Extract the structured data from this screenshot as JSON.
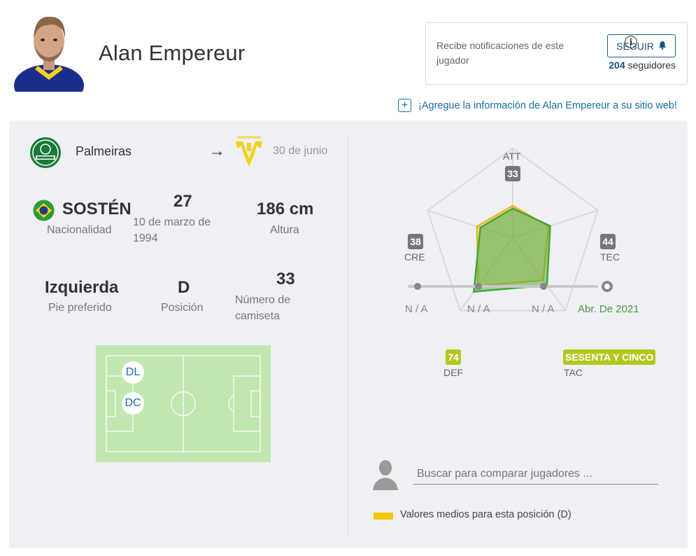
{
  "header": {
    "player_name": "Alan Empereur"
  },
  "notifications": {
    "text": "Recibe notificaciones de este jugador",
    "follow_label": "SEGUIR",
    "followers_count": "204",
    "followers_label": "seguidores"
  },
  "embed": {
    "label": "¡Agregue la información de Alan Empereur a su sitio web!"
  },
  "club": {
    "current": "Palmeiras",
    "loan_date": "30 de junio"
  },
  "stats": {
    "nationality_value": "SOSTÉN",
    "nationality_label": "Nacionalidad",
    "age_value": "27",
    "birth_date": "10 de marzo de 1994",
    "height_value": "186 cm",
    "height_label": "Altura",
    "foot_value": "Izquierda",
    "foot_label": "Pie preferido",
    "position_value": "D",
    "position_label": "Posición",
    "shirt_value": "33",
    "shirt_label": "Número de camiseta"
  },
  "pitch_positions": [
    "DL",
    "DC"
  ],
  "radar": {
    "axes": [
      {
        "key": "att",
        "label": "ATT",
        "value": "33",
        "badge": "grey"
      },
      {
        "key": "tec",
        "label": "TEC",
        "value": "44",
        "badge": "grey"
      },
      {
        "key": "tac",
        "label": "TAC",
        "value": "SESENTA Y CINCO",
        "badge": "green"
      },
      {
        "key": "def",
        "label": "DEF",
        "value": "74",
        "badge": "green"
      },
      {
        "key": "cre",
        "label": "CRE",
        "value": "38",
        "badge": "grey"
      }
    ],
    "player_color": "#3fa83a",
    "average_color": "#f2b418"
  },
  "timeline": [
    "N / A",
    "N / A",
    "N / A",
    "Abr. De 2021"
  ],
  "compare": {
    "placeholder": "Buscar para comparar jugadores ..."
  },
  "legend": {
    "label": "Valores medios para esta posición (D)",
    "color": "#f2c800"
  },
  "icons": [
    "player-photo",
    "bell-icon",
    "plus-icon",
    "palmeiras-logo",
    "arrow-right-icon",
    "verona-logo",
    "brazil-flag-icon",
    "info-icon",
    "user-silhouette-icon"
  ]
}
